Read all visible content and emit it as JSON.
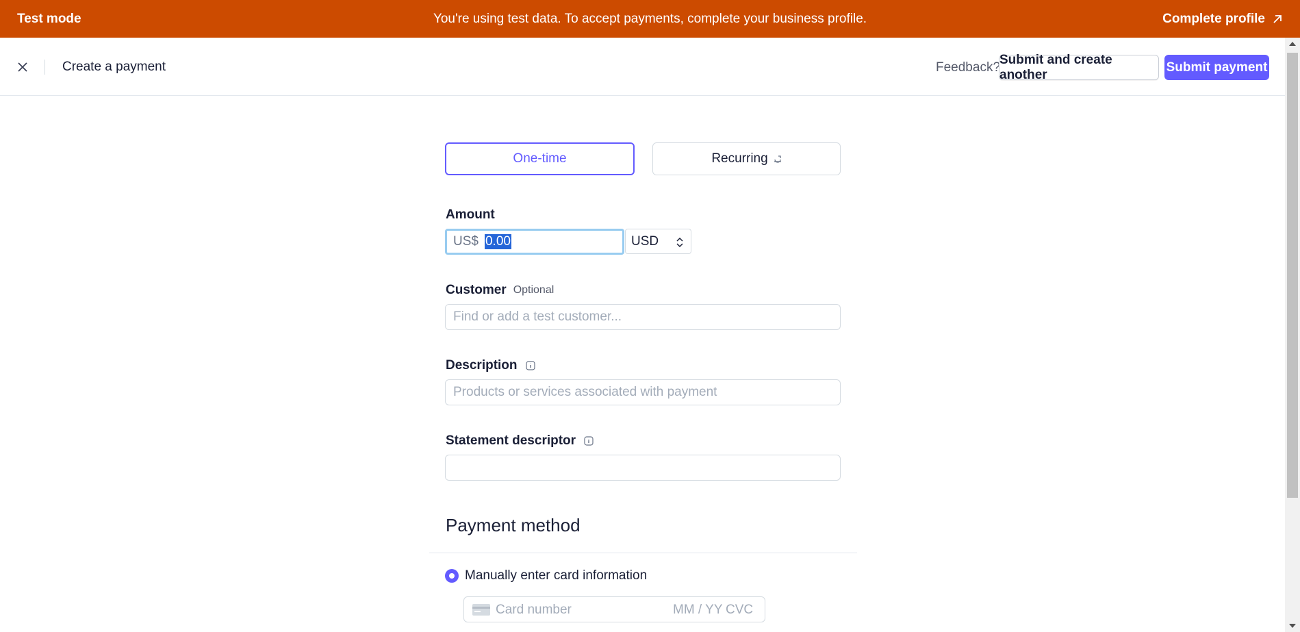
{
  "banner": {
    "mode_label": "Test mode",
    "message": "You're using test data. To accept payments, complete your business profile.",
    "action_label": "Complete profile",
    "background_color": "#cc4b00"
  },
  "header": {
    "close_icon": "close-icon",
    "title": "Create a payment",
    "feedback_label": "Feedback?",
    "secondary_button": "Submit and create another",
    "primary_button": "Submit payment",
    "accent_color": "#635bff"
  },
  "form": {
    "payment_type": {
      "options": [
        "One-time",
        "Recurring"
      ],
      "selected": "One-time",
      "recurring_icon": "recurring-icon"
    },
    "amount": {
      "label": "Amount",
      "prefix": "US$",
      "value": "0.00",
      "currency": "USD"
    },
    "customer": {
      "label": "Customer",
      "optional_tag": "Optional",
      "placeholder": "Find or add a test customer..."
    },
    "description": {
      "label": "Description",
      "placeholder": "Products or services associated with payment",
      "info_icon": "info-icon"
    },
    "statement_descriptor": {
      "label": "Statement descriptor",
      "value": "",
      "info_icon": "info-icon"
    },
    "payment_method": {
      "title": "Payment method",
      "option_label": "Manually enter card information",
      "selected": true,
      "card_number_placeholder": "Card number",
      "expiry_placeholder": "MM / YY",
      "cvc_placeholder": "CVC"
    }
  }
}
